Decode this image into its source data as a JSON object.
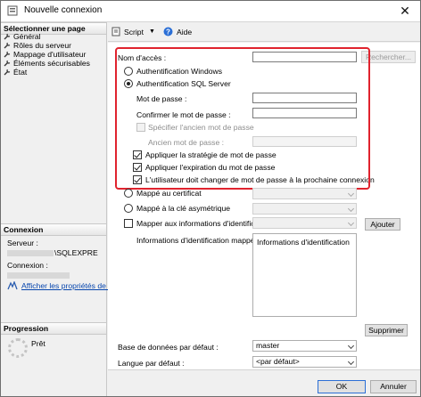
{
  "window": {
    "title": "Nouvelle connexion",
    "close_glyph": "✕"
  },
  "left": {
    "select_page_header": "Sélectionner une page",
    "nav_items": [
      {
        "label": "Général",
        "icon": "wrench-icon"
      },
      {
        "label": "Rôles du serveur",
        "icon": "wrench-icon"
      },
      {
        "label": "Mappage d'utilisateur",
        "icon": "wrench-icon"
      },
      {
        "label": "Éléments sécurisables",
        "icon": "wrench-icon"
      },
      {
        "label": "État",
        "icon": "wrench-icon"
      }
    ],
    "connection_header": "Connexion",
    "server_label": "Serveur :",
    "server_value": "\\SQLEXPRE",
    "connection_label": "Connexion :",
    "view_properties_link": "Afficher les propriétés de conn",
    "progress_header": "Progression",
    "progress_status": "Prêt"
  },
  "toolbar": {
    "script_label": "Script",
    "help_label": "Aide"
  },
  "form": {
    "login_name_label": "Nom d'accès :",
    "login_name_value": "",
    "search_button": "Rechercher...",
    "windows_auth_label": "Authentification Windows",
    "sql_auth_label": "Authentification SQL Server",
    "password_label": "Mot de passe :",
    "confirm_password_label": "Confirmer le mot de passe :",
    "specify_old_password_label": "Spécifier l'ancien mot de passe",
    "old_password_label": "Ancien mot de passe :",
    "enforce_policy_label": "Appliquer la stratégie de mot de passe",
    "enforce_expiration_label": "Appliquer l'expiration du mot de passe",
    "must_change_label": "L'utilisateur doit changer de mot de passe à la prochaine connexion",
    "cert_mapped_label": "Mappé au certificat",
    "asym_key_mapped_label": "Mappé à la clé asymétrique",
    "map_credentials_label": "Mapper aux informations d'identification",
    "add_button": "Ajouter",
    "mapped_credentials_label": "Informations d'identification mappées",
    "credentials_column_header": "Informations d'identification",
    "remove_button": "Supprimer",
    "default_db_label": "Base de données par défaut :",
    "default_db_value": "master",
    "default_lang_label": "Langue par défaut :",
    "default_lang_value": "<par défaut>"
  },
  "footer": {
    "ok_button": "OK",
    "cancel_button": "Annuler"
  },
  "colors": {
    "highlight_border": "#e0232e",
    "link": "#0645ad"
  }
}
